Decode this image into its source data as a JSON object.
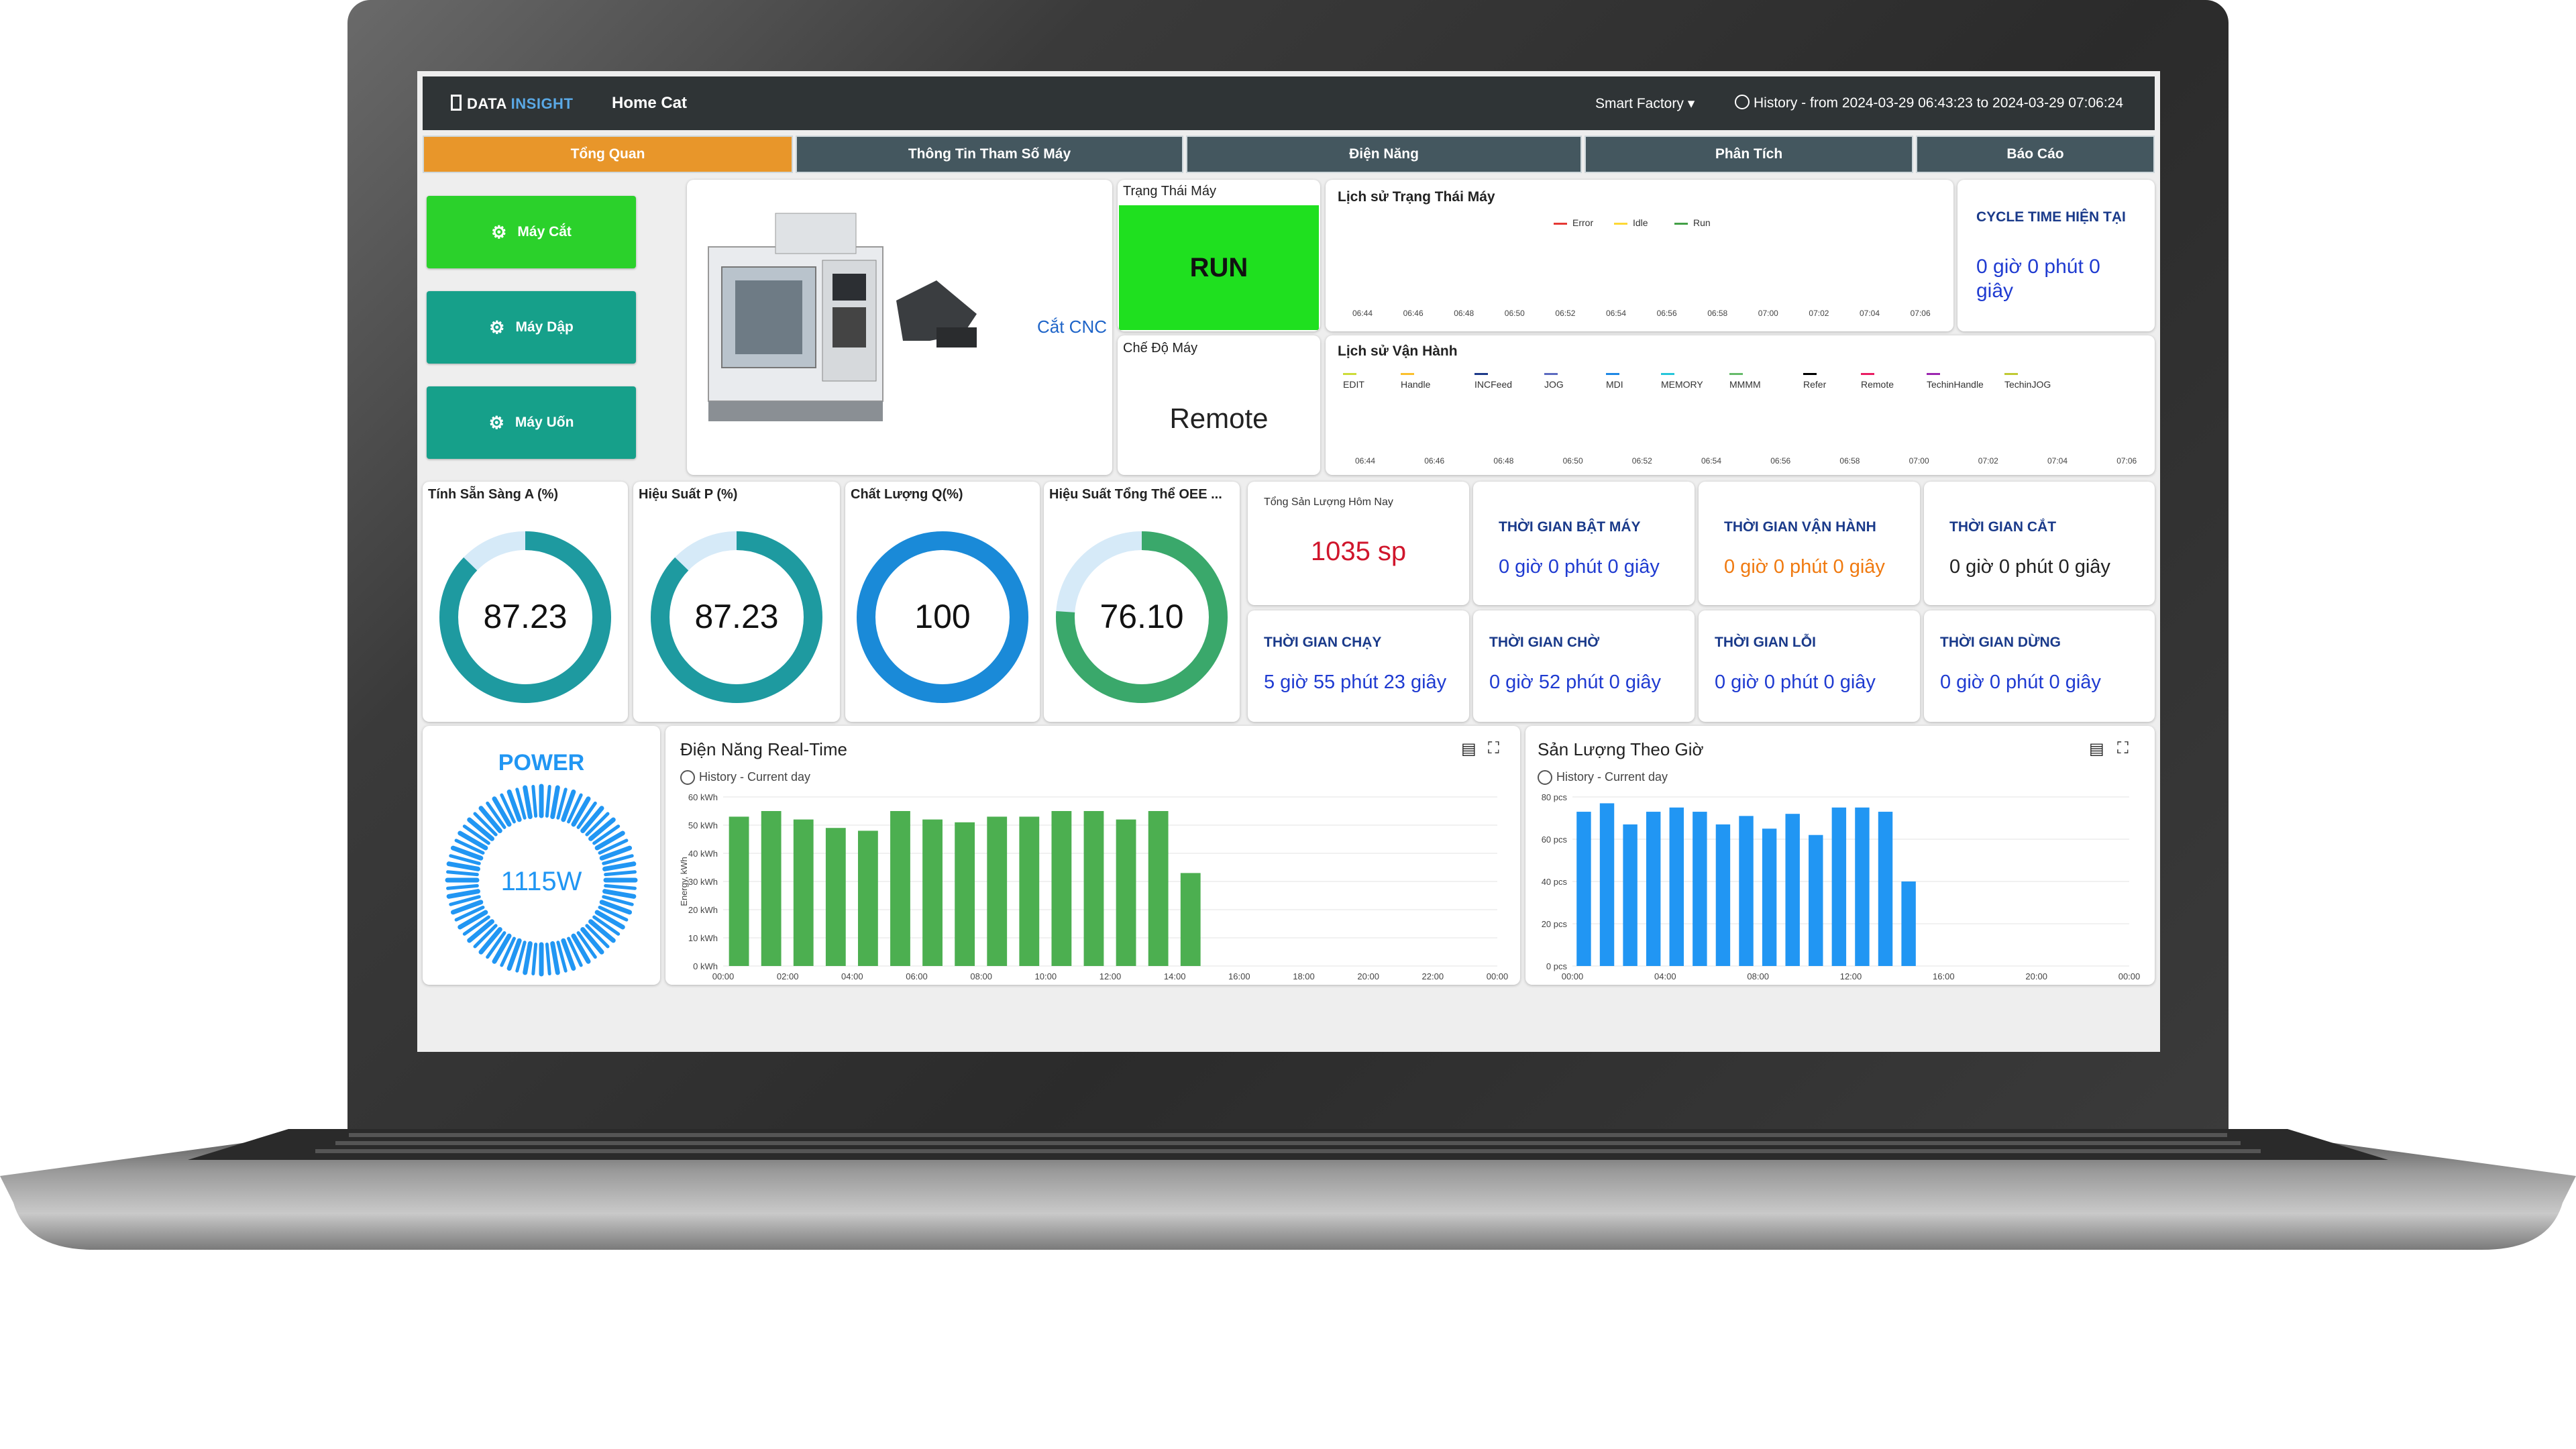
{
  "app": {
    "logo_a": "DATA",
    "logo_b": "INSIGHT",
    "page": "Home Cat",
    "factory": "Smart Factory",
    "history": "History - from 2024-03-29 06:43:23 to 2024-03-29 07:06:24"
  },
  "tabs": [
    "Tổng Quan",
    "Thông Tin Tham Số Máy",
    "Điện Năng",
    "Phân Tích",
    "Báo Cáo"
  ],
  "machines": [
    "Máy Cắt",
    "Máy Dập",
    "Máy Uốn"
  ],
  "machine_name": "Cắt CNC",
  "status": {
    "title": "Trạng Thái Máy",
    "value": "RUN",
    "mode_title": "Chế Độ Máy",
    "mode_value": "Remote"
  },
  "state_history": {
    "title": "Lịch sử Trạng Thái Máy",
    "legend": [
      {
        "name": "Error",
        "color": "#e53935"
      },
      {
        "name": "Idle",
        "color": "#fdd835"
      },
      {
        "name": "Run",
        "color": "#43a047"
      }
    ],
    "ticks": [
      "06:44",
      "06:46",
      "06:48",
      "06:50",
      "06:52",
      "06:54",
      "06:56",
      "06:58",
      "07:00",
      "07:02",
      "07:04",
      "07:06"
    ]
  },
  "op_history": {
    "title": "Lịch sử Vận Hành",
    "legend": [
      {
        "name": "EDIT",
        "color": "#cddc39"
      },
      {
        "name": "Handle",
        "color": "#fbc02d"
      },
      {
        "name": "INCFeed",
        "color": "#1e3a8a"
      },
      {
        "name": "JOG",
        "color": "#5c6bc0"
      },
      {
        "name": "MDI",
        "color": "#1e88e5"
      },
      {
        "name": "MEMORY",
        "color": "#26c6da"
      },
      {
        "name": "MMMM",
        "color": "#66bb6a"
      },
      {
        "name": "Refer",
        "color": "#000000"
      },
      {
        "name": "Remote",
        "color": "#e91e63"
      },
      {
        "name": "TechinHandle",
        "color": "#9c27b0"
      },
      {
        "name": "TechinJOG",
        "color": "#c0ca33"
      }
    ],
    "ticks": [
      "06:44",
      "06:46",
      "06:48",
      "06:50",
      "06:52",
      "06:54",
      "06:56",
      "06:58",
      "07:00",
      "07:02",
      "07:04",
      "07:06"
    ]
  },
  "cycle": {
    "title": "CYCLE TIME HIỆN TẠI",
    "value": "0 giờ 0 phút 0 giây"
  },
  "gauges": [
    {
      "title": "Tính Sẵn Sàng A (%)",
      "value": "87.23",
      "pct": 87.23,
      "color": "#1e9aa0",
      "track": "#d6eaf8"
    },
    {
      "title": "Hiệu Suất P (%)",
      "value": "87.23",
      "pct": 87.23,
      "color": "#1e9aa0",
      "track": "#d6eaf8"
    },
    {
      "title": "Chất Lượng Q(%)",
      "value": "100",
      "pct": 100,
      "color": "#1a8ad8",
      "track": "#d6eaf8"
    },
    {
      "title": "Hiệu Suất Tổng Thể OEE ...",
      "value": "76.10",
      "pct": 76.1,
      "color": "#3aa86b",
      "track": "#d6eaf8"
    }
  ],
  "output_today": {
    "title": "Tổng Sản Lượng Hôm Nay",
    "value": "1035 sp"
  },
  "times": [
    {
      "title": "THỜI GIAN BẬT MÁY",
      "value": "0 giờ 0 phút 0 giây",
      "color": "#1f3bd1"
    },
    {
      "title": "THỜI GIAN VẬN HÀNH",
      "value": "0 giờ 0 phút 0 giây",
      "color": "#f07a10"
    },
    {
      "title": "THỜI GIAN CẮT",
      "value": "0 giờ 0 phút 0 giây",
      "color": "#222222"
    },
    {
      "title": "THỜI GIAN CHẠY",
      "value": "5 giờ 55 phút 23 giây",
      "color": "#1f3bd1"
    },
    {
      "title": "THỜI GIAN CHỜ",
      "value": "0 giờ 52 phút 0 giây",
      "color": "#1f3bd1"
    },
    {
      "title": "THỜI GIAN LỖI",
      "value": "0 giờ 0 phút 0 giây",
      "color": "#1f3bd1"
    },
    {
      "title": "THỜI GIAN DỪNG",
      "value": "0 giờ 0 phút 0 giây",
      "color": "#1f3bd1"
    }
  ],
  "power": {
    "title": "POWER",
    "value": "1115W"
  },
  "chart_data": [
    {
      "type": "bar",
      "title": "Điện Năng Real-Time",
      "subtitle": "History - Current day",
      "ylabel": "Energy, kWh",
      "ylim": [
        0,
        60
      ],
      "yticks": [
        "0 kWh",
        "10 kWh",
        "20 kWh",
        "30 kWh",
        "40 kWh",
        "50 kWh",
        "60 kWh"
      ],
      "xticks": [
        "00:00",
        "02:00",
        "04:00",
        "06:00",
        "08:00",
        "10:00",
        "12:00",
        "14:00",
        "16:00",
        "18:00",
        "20:00",
        "22:00",
        "00:00"
      ],
      "color": "#4caf50",
      "categories": [
        "00:00",
        "01:00",
        "02:00",
        "03:00",
        "04:00",
        "05:00",
        "06:00",
        "07:00",
        "08:00",
        "09:00",
        "10:00",
        "11:00",
        "12:00",
        "13:00",
        "14:00",
        "15:00"
      ],
      "values": [
        53,
        55,
        52,
        49,
        48,
        55,
        52,
        51,
        53,
        53,
        55,
        55,
        52,
        55,
        33,
        0
      ]
    },
    {
      "type": "bar",
      "title": "Sản Lượng Theo Giờ",
      "subtitle": "History - Current day",
      "ylim": [
        0,
        80
      ],
      "yticks": [
        "0 pcs",
        "20 pcs",
        "40 pcs",
        "60 pcs",
        "80 pcs"
      ],
      "xticks": [
        "00:00",
        "04:00",
        "08:00",
        "12:00",
        "16:00",
        "20:00",
        "00:00"
      ],
      "color": "#2196f3",
      "categories": [
        "00:00",
        "01:00",
        "02:00",
        "03:00",
        "04:00",
        "05:00",
        "06:00",
        "07:00",
        "08:00",
        "09:00",
        "10:00",
        "11:00",
        "12:00",
        "13:00",
        "14:00"
      ],
      "values": [
        73,
        77,
        67,
        73,
        75,
        73,
        67,
        71,
        65,
        72,
        62,
        75,
        75,
        73,
        40
      ]
    }
  ]
}
